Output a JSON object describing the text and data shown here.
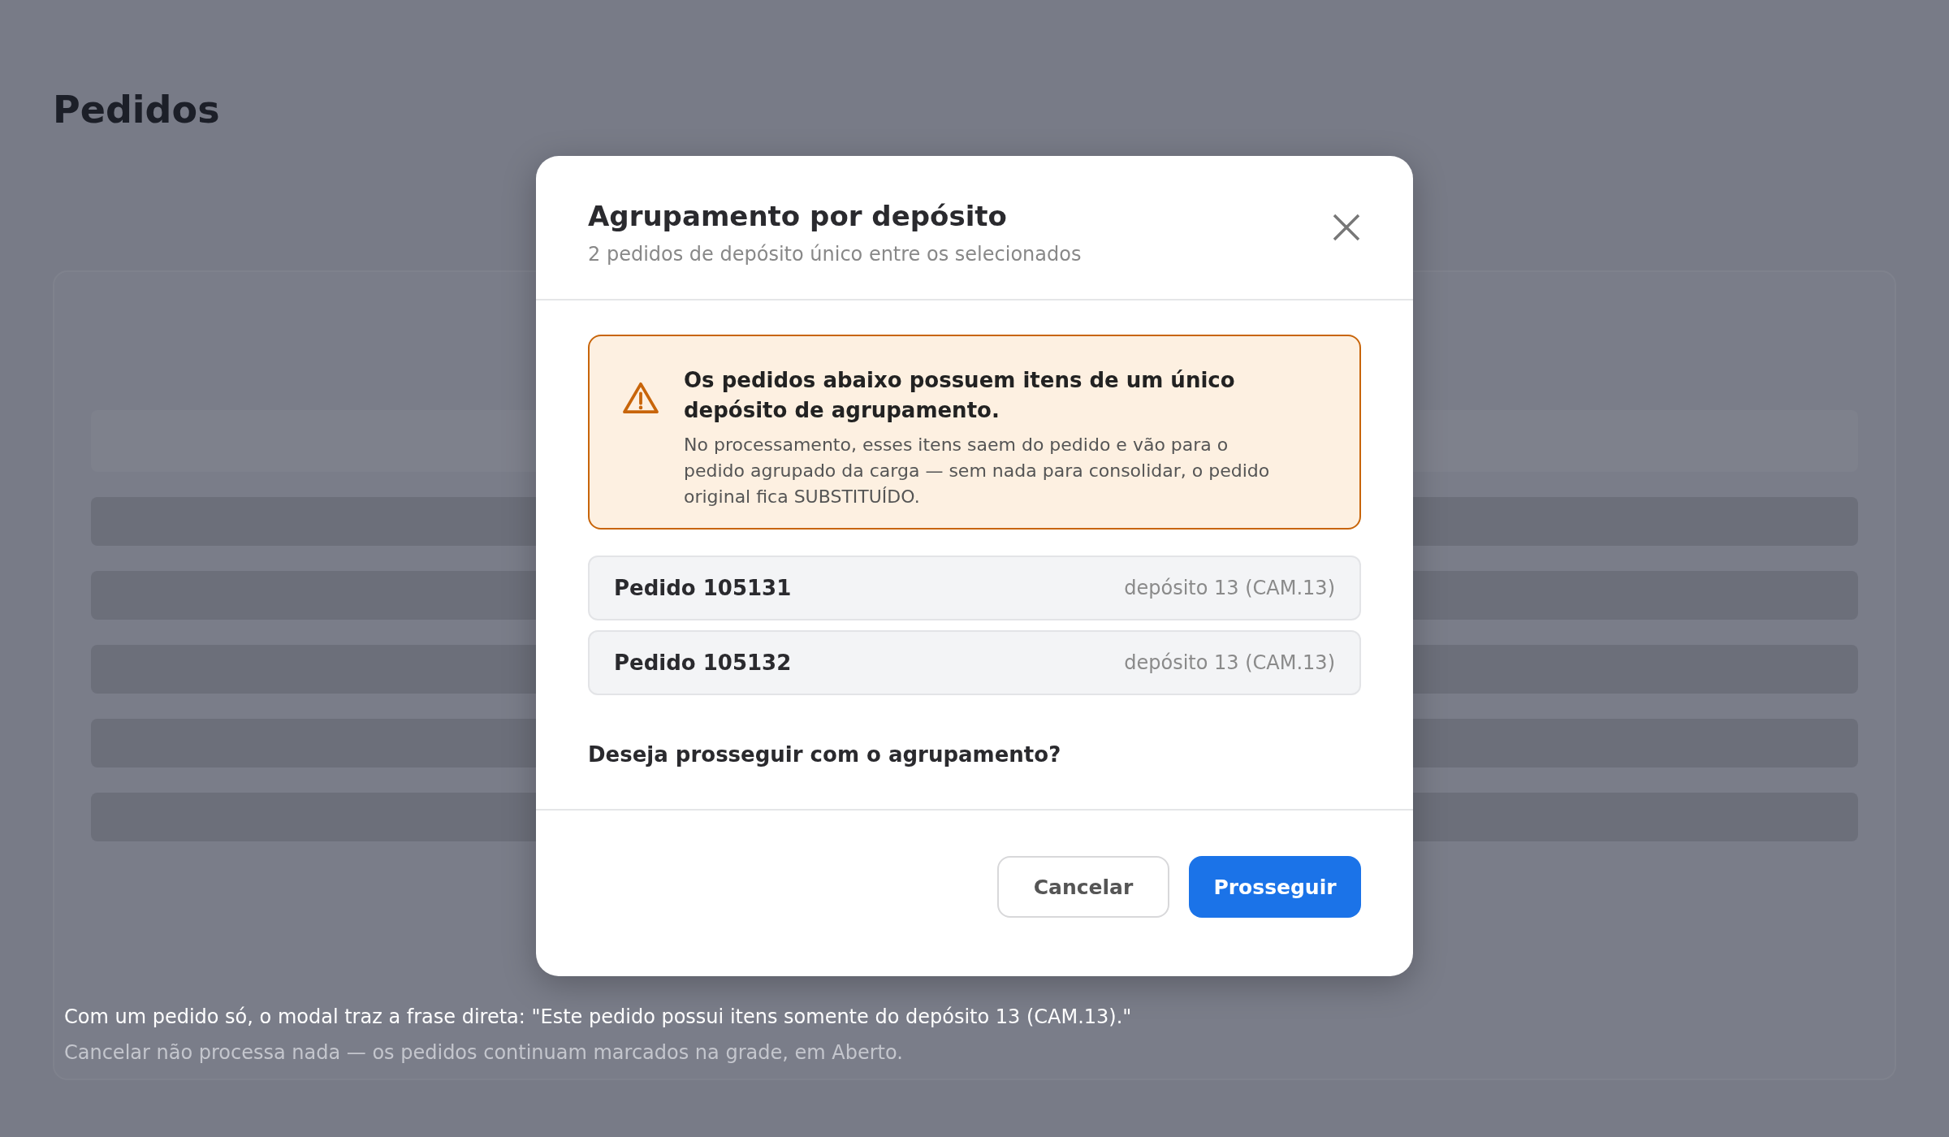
{
  "page": {
    "title": "Pedidos"
  },
  "modal": {
    "title": "Agrupamento por depósito",
    "subtitle": "2 pedidos de depósito único entre os selecionados",
    "alert": {
      "title": "Os pedidos abaixo possuem itens de um único depósito de agrupamento.",
      "body": "No processamento, esses itens saem do pedido e vão para o pedido agrupado da carga — sem nada para consolidar, o pedido original fica SUBSTITUÍDO."
    },
    "orders": [
      {
        "name": "Pedido 105131",
        "warehouse": "depósito 13 (CAM.13)"
      },
      {
        "name": "Pedido 105132",
        "warehouse": "depósito 13 (CAM.13)"
      }
    ],
    "question": "Deseja prosseguir com o agrupamento?",
    "buttons": [
      {
        "label": "Cancelar",
        "kind": "secondary"
      },
      {
        "label": "Prosseguir",
        "kind": "primary"
      }
    ]
  },
  "notes": [
    {
      "text": "Com um pedido só, o modal traz a frase direta: \"Este pedido possui itens somente do depósito 13 (CAM.13).\"",
      "kind": "main"
    },
    {
      "text": "Cancelar não processa nada — os pedidos continuam marcados na grade, em Aberto.",
      "kind": "muted"
    }
  ]
}
